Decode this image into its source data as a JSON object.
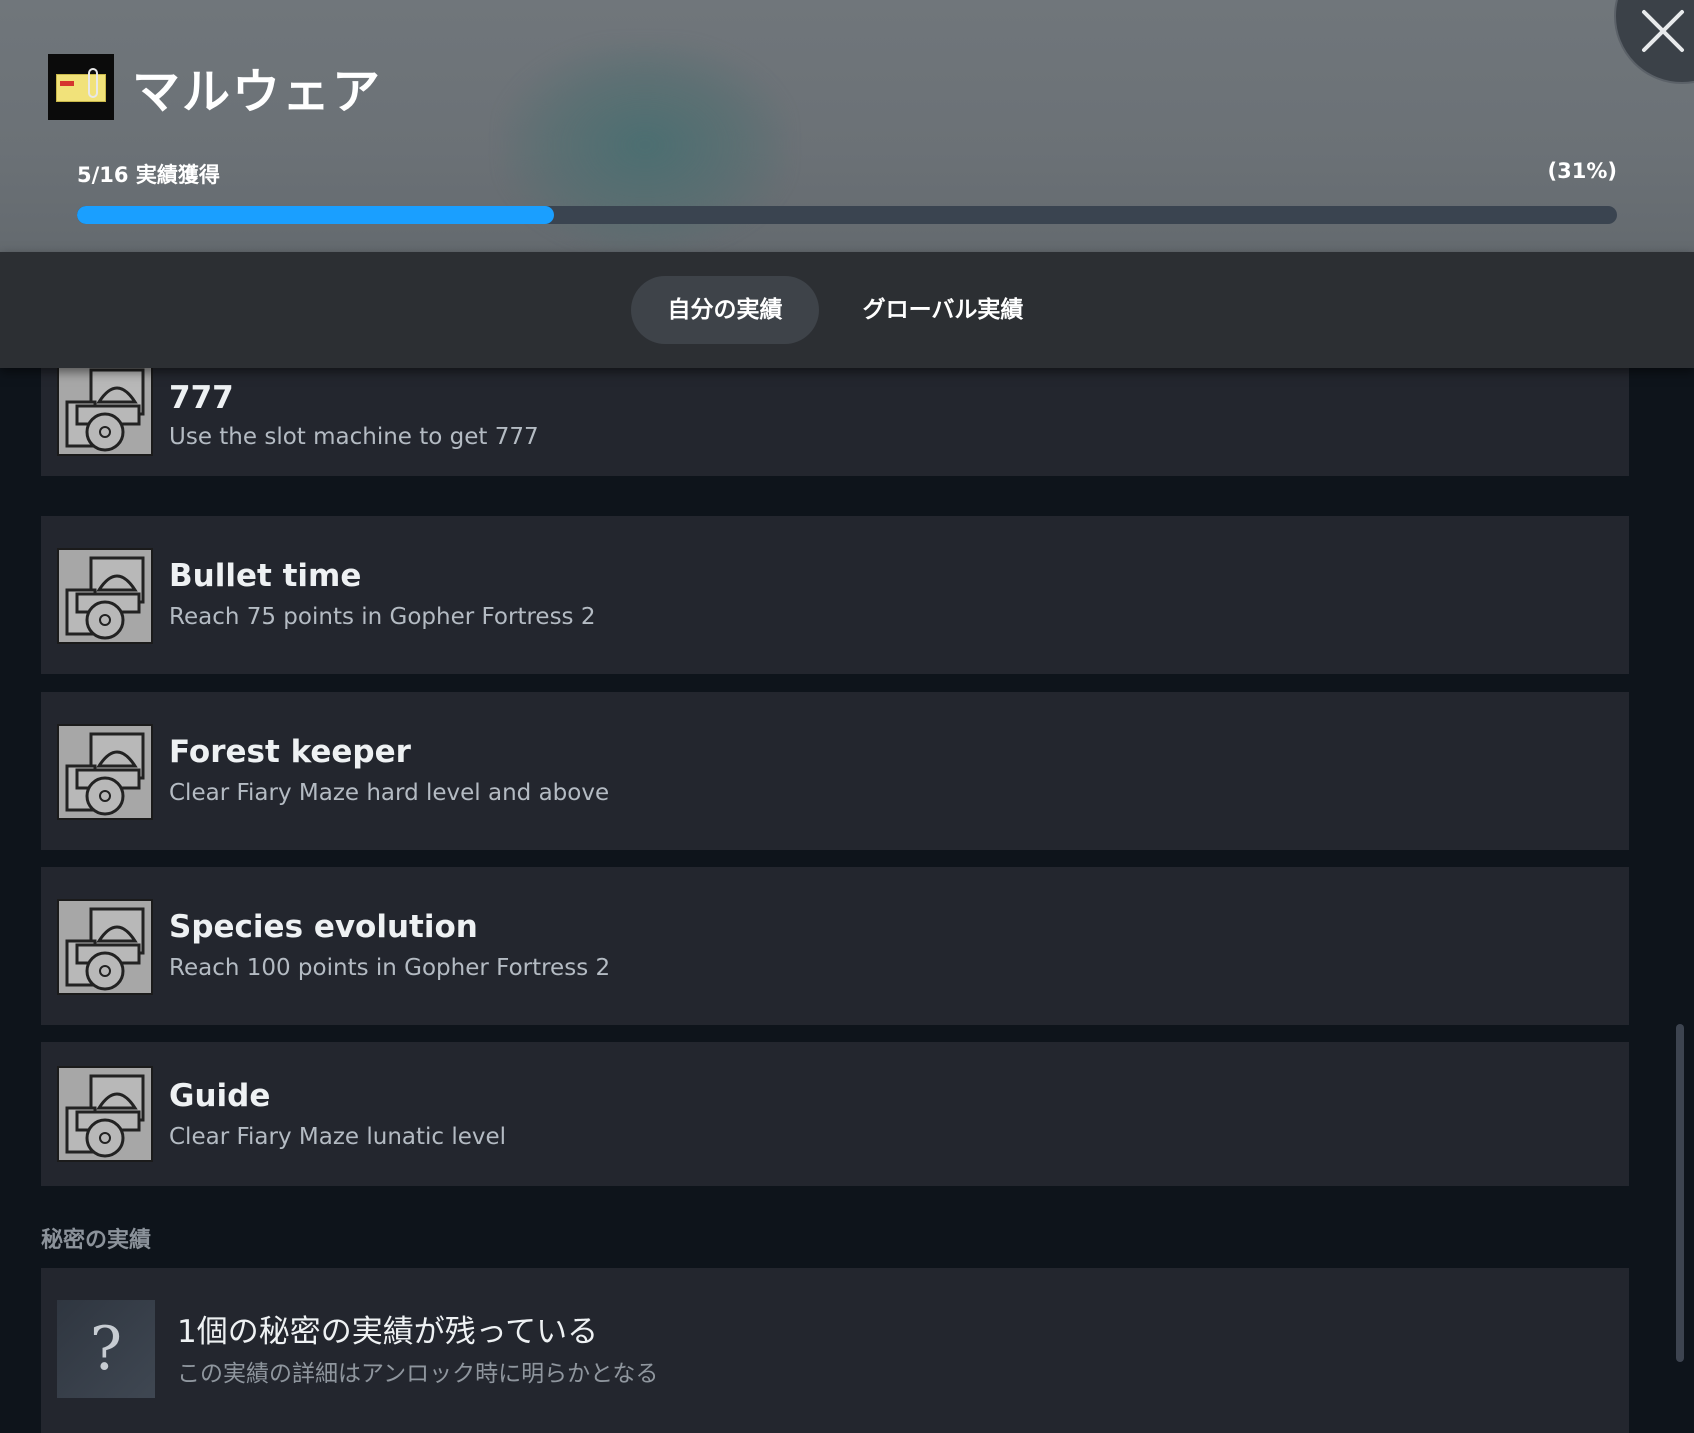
{
  "header": {
    "game_title": "マルウェア",
    "progress_label": "5/16 実績獲得",
    "progress_percent_text": "(31%)",
    "progress_fraction": 0.31
  },
  "tabs": [
    {
      "label": "自分の実績",
      "active": true
    },
    {
      "label": "グローバル実績",
      "active": false
    }
  ],
  "achievements": [
    {
      "name": "777",
      "description": "Use the slot machine to get 777"
    },
    {
      "name": "Bullet time",
      "description": "Reach 75 points in Gopher Fortress 2"
    },
    {
      "name": "Forest keeper",
      "description": "Clear Fiary Maze hard level and above"
    },
    {
      "name": "Species evolution",
      "description": "Reach 100 points in Gopher Fortress 2"
    },
    {
      "name": "Guide",
      "description": "Clear Fiary Maze lunatic level"
    }
  ],
  "secret": {
    "section_label": "秘密の実績",
    "icon_glyph": "?",
    "title": "1個の秘密の実績が残っている",
    "subtitle": "この実績の詳細はアンロック時に明らかとなる"
  },
  "colors": {
    "accent": "#1a9fff",
    "row_bg": "#23262e",
    "page_bg": "#0e141b"
  }
}
